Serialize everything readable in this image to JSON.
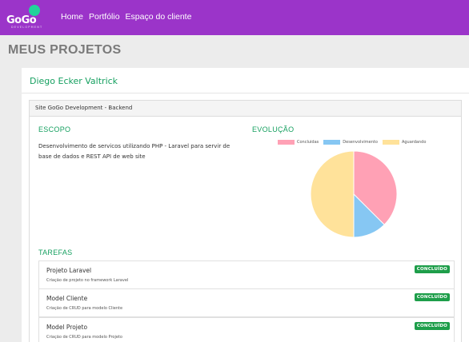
{
  "brand": {
    "name": "GoGo",
    "tagline": "DEVELOPMENT"
  },
  "nav": [
    {
      "label": "Home"
    },
    {
      "label": "Portfólio"
    },
    {
      "label": "Espaço do cliente"
    }
  ],
  "page": {
    "title": "MEUS PROJETOS"
  },
  "client": {
    "name": "Diego Ecker Valtrick"
  },
  "project": {
    "title": "Site GoGo Development - Backend",
    "scope_heading": "ESCOPO",
    "scope_text": "Desenvolvimento de servicos utilizando PHP - Laravel para servir de base de dados e REST API de web site",
    "evolution_heading": "EVOLUÇÃO",
    "tasks_heading": "TAREFAS"
  },
  "chart_data": {
    "type": "pie",
    "labels": [
      "Concluidas",
      "Desenvolvimento",
      "Aguardando"
    ],
    "values": [
      3,
      1,
      4
    ],
    "colors": [
      "#ffa1b5",
      "#86c7f3",
      "#ffe29a"
    ]
  },
  "tasks": [
    {
      "name": "Projeto Laravel",
      "description": "Criação de projeto no framework Laravel",
      "status": "CONCLUÍDO"
    },
    {
      "name": "Model Cliente",
      "description": "Criação de CRUD para modelo Cliente",
      "status": "CONCLUÍDO"
    },
    {
      "name": "Model Projeto",
      "description": "Criação de CRUD para modelo Projeto",
      "status": "CONCLUÍDO"
    }
  ],
  "colors": {
    "topbar": "#9b34c9",
    "accent": "#16a060",
    "badge": "#1e9e4a"
  }
}
